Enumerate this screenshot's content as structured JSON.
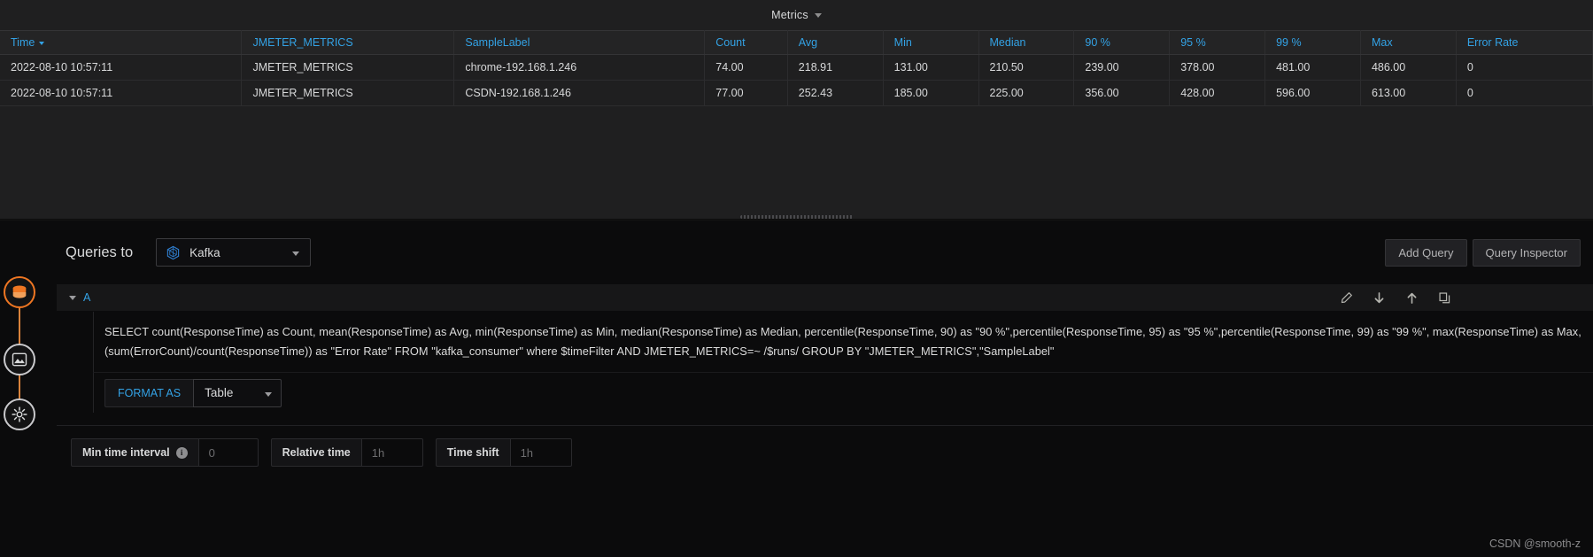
{
  "panel": {
    "title": "Metrics",
    "caret_icon": "chevron-down-icon"
  },
  "table": {
    "columns": [
      {
        "key": "time",
        "label": "Time",
        "sorted": true
      },
      {
        "key": "metrics",
        "label": "JMETER_METRICS",
        "sorted": false
      },
      {
        "key": "label",
        "label": "SampleLabel",
        "sorted": false
      },
      {
        "key": "count",
        "label": "Count",
        "sorted": false
      },
      {
        "key": "avg",
        "label": "Avg",
        "sorted": false
      },
      {
        "key": "min",
        "label": "Min",
        "sorted": false
      },
      {
        "key": "median",
        "label": "Median",
        "sorted": false
      },
      {
        "key": "p90",
        "label": "90 %",
        "sorted": false
      },
      {
        "key": "p95",
        "label": "95 %",
        "sorted": false
      },
      {
        "key": "p99",
        "label": "99 %",
        "sorted": false
      },
      {
        "key": "max",
        "label": "Max",
        "sorted": false
      },
      {
        "key": "error",
        "label": "Error Rate",
        "sorted": false
      }
    ],
    "rows": [
      {
        "time": "2022-08-10 10:57:11",
        "metrics": "JMETER_METRICS",
        "label": "chrome-192.168.1.246",
        "count": "74.00",
        "avg": "218.91",
        "min": "131.00",
        "median": "210.50",
        "p90": "239.00",
        "p95": "378.00",
        "p99": "481.00",
        "max": "486.00",
        "error": "0"
      },
      {
        "time": "2022-08-10 10:57:11",
        "metrics": "JMETER_METRICS",
        "label": "CSDN-192.168.1.246",
        "count": "77.00",
        "avg": "252.43",
        "min": "185.00",
        "median": "225.00",
        "p90": "356.00",
        "p95": "428.00",
        "p99": "596.00",
        "max": "613.00",
        "error": "0"
      }
    ]
  },
  "editor": {
    "queries_to_label": "Queries to",
    "datasource": {
      "name": "Kafka",
      "icon": "influxdb-datasource-icon",
      "caret_icon": "chevron-down-icon"
    },
    "actions": [
      {
        "name": "add-query-button",
        "label": "Add Query"
      },
      {
        "name": "query-inspector-button",
        "label": "Query Inspector"
      }
    ],
    "query": {
      "ref_id": "A",
      "collapse_icon": "chevron-down-icon",
      "row_icons": [
        {
          "name": "edit-query-icon",
          "title": "pencil"
        },
        {
          "name": "move-query-down-icon",
          "title": "arrow-down"
        },
        {
          "name": "move-query-up-icon",
          "title": "arrow-up"
        },
        {
          "name": "duplicate-query-icon",
          "title": "copy"
        }
      ],
      "sql": "SELECT count(ResponseTime) as Count, mean(ResponseTime) as Avg, min(ResponseTime) as Min, median(ResponseTime) as Median, percentile(ResponseTime, 90) as \"90 %\",percentile(ResponseTime, 95) as \"95 %\",percentile(ResponseTime, 99) as \"99 %\", max(ResponseTime) as Max,(sum(ErrorCount)/count(ResponseTime)) as \"Error Rate\" FROM \"kafka_consumer\" where $timeFilter AND  JMETER_METRICS=~ /$runs/  GROUP BY \"JMETER_METRICS\",\"SampleLabel\"",
      "format_as_label": "FORMAT AS",
      "format_as_value": "Table"
    },
    "options": [
      {
        "name": "min-time-interval",
        "label": "Min time interval",
        "has_info": true,
        "value": "",
        "placeholder": "0"
      },
      {
        "name": "relative-time",
        "label": "Relative time",
        "has_info": false,
        "value": "",
        "placeholder": "1h"
      },
      {
        "name": "time-shift",
        "label": "Time shift",
        "has_info": false,
        "value": "",
        "placeholder": "1h"
      }
    ]
  },
  "watermark": "CSDN @smooth-z",
  "colors": {
    "accent_blue": "#33a2e5",
    "panel_bg": "#1f1f20",
    "editor_bg": "#0b0b0c",
    "orange": "#d8823b"
  }
}
